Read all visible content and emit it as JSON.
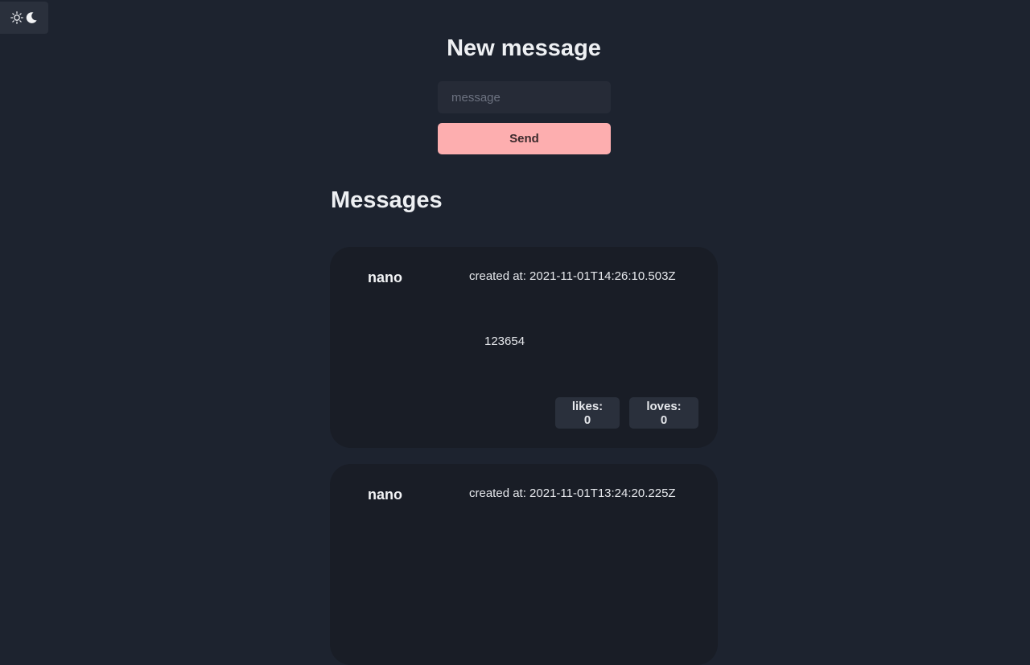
{
  "theme_toggle": {
    "icons": [
      "sun-icon",
      "moon-icon"
    ]
  },
  "compose": {
    "title": "New message",
    "input_placeholder": "message",
    "input_value": "",
    "send_label": "Send"
  },
  "messages_title": "Messages",
  "messages": [
    {
      "author": "nano",
      "created": "created at: 2021-11-01T14:26:10.503Z",
      "body": "123654",
      "likes_label": "likes: 0",
      "loves_label": "loves: 0"
    },
    {
      "author": "nano",
      "created": "created at: 2021-11-01T13:24:20.225Z"
    }
  ],
  "colors": {
    "background": "#1d232f",
    "card": "#191d26",
    "accent": "#fdaeaf",
    "control": "#2a303c"
  }
}
